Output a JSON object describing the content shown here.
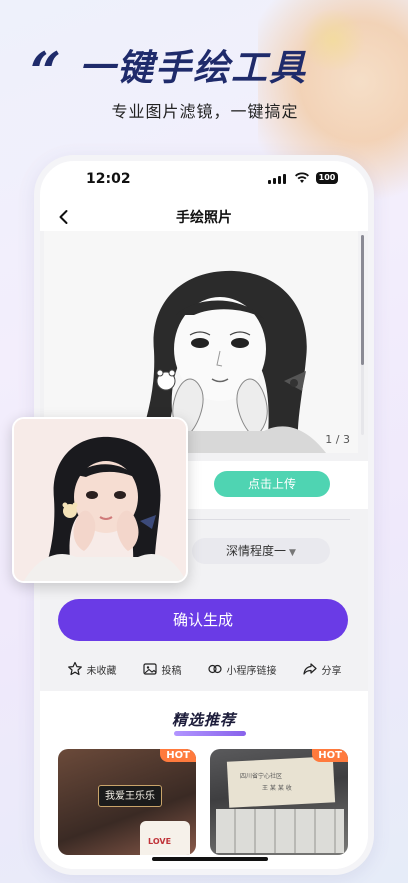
{
  "headline": {
    "quote_mark": "“",
    "title": "一键手绘工具",
    "subtitle": "专业图片滤镜，一键搞定"
  },
  "status_bar": {
    "time": "12:02",
    "battery": "100"
  },
  "nav": {
    "title": "手绘照片"
  },
  "editor": {
    "page_indicator": "1 / 3",
    "upload_label": "点击上传",
    "style_select": {
      "value": "深情程度一",
      "caret": "▼"
    },
    "confirm_label": "确认生成"
  },
  "actions": [
    {
      "label": "未收藏",
      "icon": "star-icon"
    },
    {
      "label": "投稿",
      "icon": "image-icon"
    },
    {
      "label": "小程序链接",
      "icon": "link-icon"
    },
    {
      "label": "分享",
      "icon": "share-icon"
    }
  ],
  "recommend": {
    "title": "精选推荐",
    "cards": [
      {
        "badge": "HOT",
        "sign_text": "我爱王乐乐",
        "cake_text": "LOVE"
      },
      {
        "badge": "HOT",
        "env_line1": "四川省宁心社区",
        "env_line2": "王 某 某 收"
      }
    ]
  },
  "colors": {
    "headline": "#1f2b6b",
    "upload_button": "#4fd4b2",
    "confirm_button": "#6a3be6",
    "hot_badge": "#ff7a3d"
  }
}
